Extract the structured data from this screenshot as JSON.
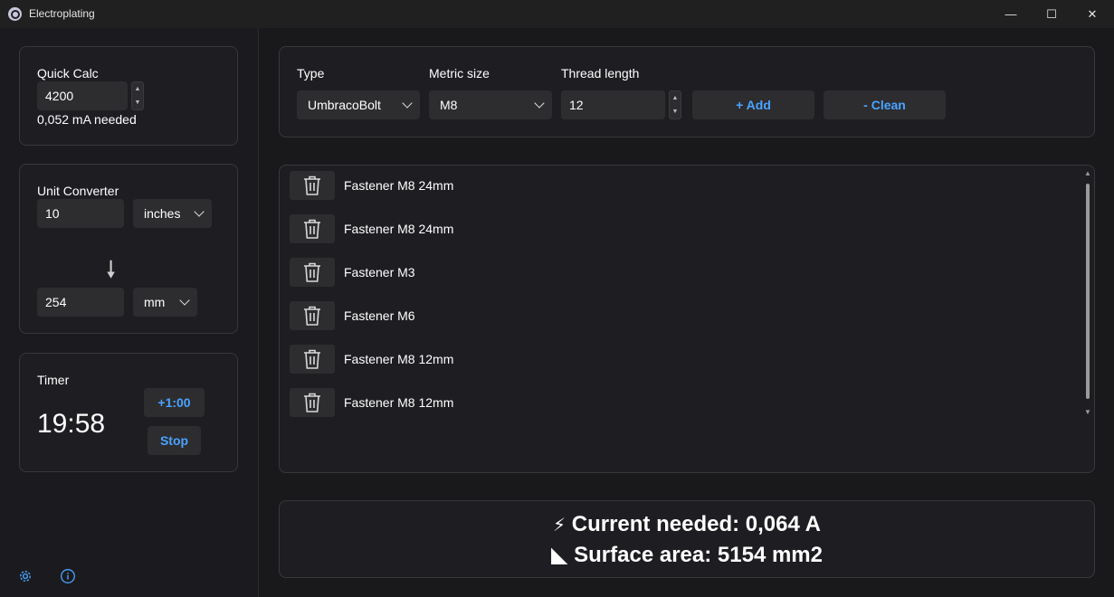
{
  "window": {
    "title": "Electroplating",
    "controls": {
      "minimize": "—",
      "maximize": "☐",
      "close": "✕"
    }
  },
  "quick_calc": {
    "title": "Quick Calc",
    "value": "4200",
    "result": "0,052 mA needed"
  },
  "unit_converter": {
    "title": "Unit Converter",
    "from_value": "10",
    "from_unit": "inches",
    "to_value": "254",
    "to_unit": "mm",
    "arrow": "🠗"
  },
  "timer": {
    "title": "Timer",
    "time": "19:58",
    "add_label": "+1:00",
    "stop_label": "Stop"
  },
  "toolbar": {
    "type_label": "Type",
    "type_value": "UmbracoBolt",
    "size_label": "Metric size",
    "size_value": "M8",
    "length_label": "Thread length",
    "length_value": "12",
    "add_label": "+ Add",
    "clean_label": "- Clean"
  },
  "fasteners": [
    {
      "label": "Fastener M8 24mm"
    },
    {
      "label": "Fastener M8 24mm"
    },
    {
      "label": "Fastener M3"
    },
    {
      "label": "Fastener M6"
    },
    {
      "label": "Fastener M8 12mm"
    },
    {
      "label": "Fastener M8 12mm"
    }
  ],
  "summary": {
    "current_icon": "⚡",
    "current_text": "Current needed: 0,064 A",
    "area_icon": "◣",
    "area_text": "Surface area: 5154 mm2"
  },
  "footer_icons": [
    "gear-icon",
    "info-icon"
  ],
  "colors": {
    "accent": "#4aa3ff",
    "background": "#1c1c1c",
    "panel": "#1e1e22"
  }
}
